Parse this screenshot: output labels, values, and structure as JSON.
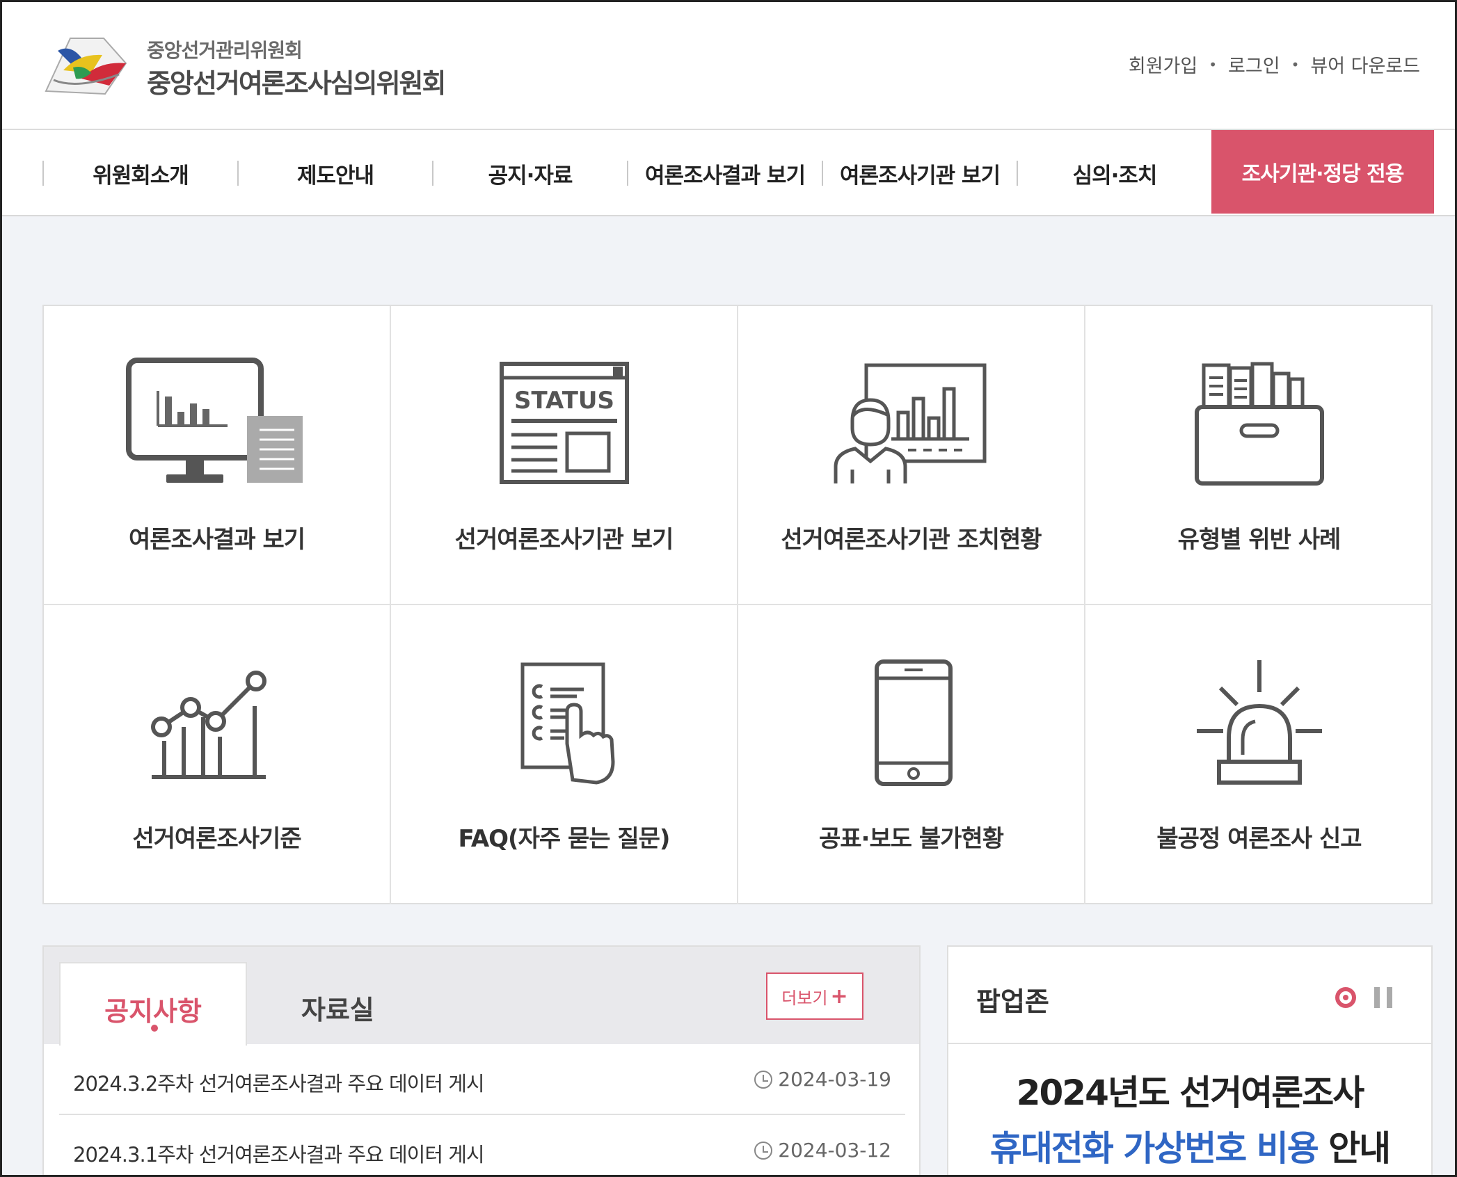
{
  "header": {
    "logo_sub": "중앙선거관리위원회",
    "logo_main": "중앙선거여론조사심의위원회",
    "util_links": [
      "회원가입",
      "로그인",
      "뷰어 다운로드"
    ]
  },
  "nav": {
    "items": [
      "위원회소개",
      "제도안내",
      "공지·자료",
      "여론조사결과 보기",
      "여론조사기관 보기",
      "심의·조치"
    ],
    "special": "조사기관·정당 전용"
  },
  "tiles": [
    {
      "label": "여론조사결과 보기",
      "icon": "monitor-chart-icon"
    },
    {
      "label": "선거여론조사기관 보기",
      "icon": "status-document-icon",
      "icon_text": "STATUS"
    },
    {
      "label": "선거여론조사기관 조치현황",
      "icon": "presenter-chart-icon"
    },
    {
      "label": "유형별 위반 사례",
      "icon": "file-box-icon"
    },
    {
      "label": "선거여론조사기준",
      "icon": "line-graph-icon"
    },
    {
      "label": "FAQ(자주 묻는 질문)",
      "icon": "checklist-hand-icon"
    },
    {
      "label": "공표·보도 불가현황",
      "icon": "mobile-phone-icon"
    },
    {
      "label": "불공정 여론조사 신고",
      "icon": "siren-icon"
    }
  ],
  "board": {
    "tab_active": "공지사항",
    "tab_other": "자료실",
    "more_label": "더보기",
    "notices": [
      {
        "title": "2024.3.2주차 선거여론조사결과 주요 데이터 게시",
        "date": "2024-03-19"
      },
      {
        "title": "2024.3.1주차 선거여론조사결과 주요 데이터 게시",
        "date": "2024-03-12"
      }
    ]
  },
  "popup": {
    "title": "팝업존",
    "line1": "2024년도 선거여론조사",
    "line2_highlight": "휴대전화 가상번호 비용",
    "line2_rest": " 안내"
  },
  "colors": {
    "accent": "#d9546b",
    "highlight_blue": "#2f66c4",
    "icon_gray": "#555555"
  }
}
